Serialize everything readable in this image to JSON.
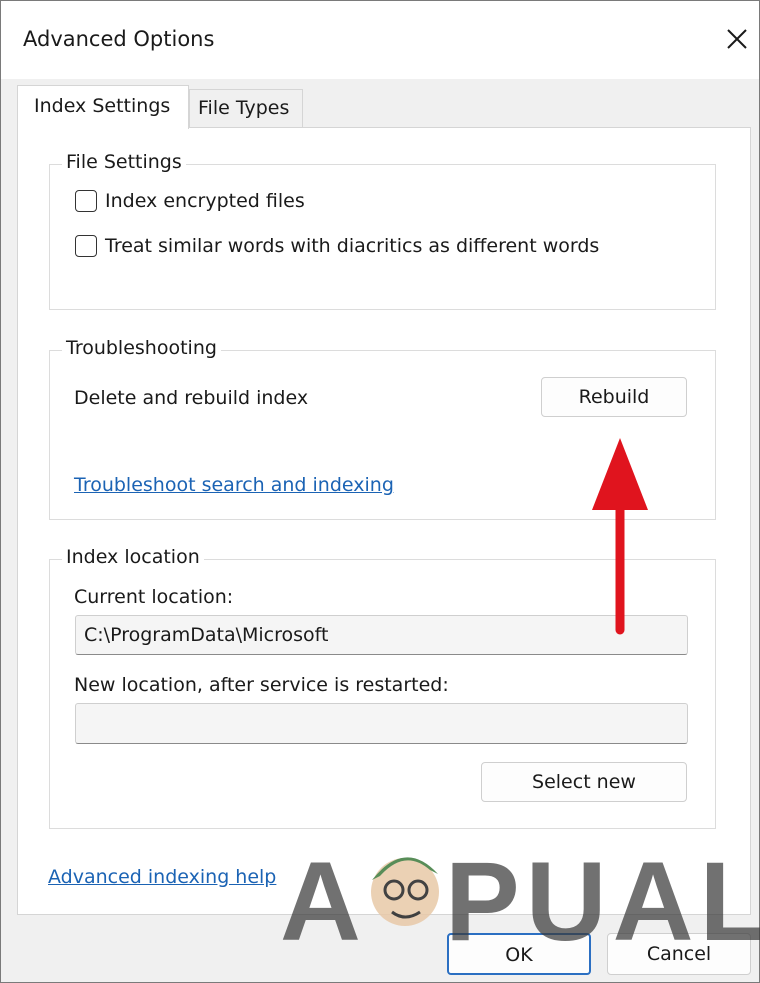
{
  "window": {
    "title": "Advanced Options",
    "close_icon": "close-icon"
  },
  "tabs": [
    {
      "label": "Index Settings",
      "active": true
    },
    {
      "label": "File Types",
      "active": false
    }
  ],
  "file_settings": {
    "legend": "File Settings",
    "options": [
      {
        "label": "Index encrypted files",
        "checked": false
      },
      {
        "label": "Treat similar words with diacritics as different words",
        "checked": false
      }
    ]
  },
  "troubleshooting": {
    "legend": "Troubleshooting",
    "rebuild_text": "Delete and rebuild index",
    "rebuild_button": "Rebuild",
    "troubleshoot_link": "Troubleshoot search and indexing"
  },
  "index_location": {
    "legend": "Index location",
    "current_label": "Current location:",
    "current_value": "C:\\ProgramData\\Microsoft",
    "new_label": "New location, after service is restarted:",
    "new_value": "",
    "select_button": "Select new"
  },
  "help_link": "Advanced indexing help",
  "footer": {
    "ok_button": "OK",
    "cancel_button": "Cancel"
  },
  "watermark_text": "APPUALS",
  "colors": {
    "link": "#1b63b4",
    "arrow": "#e0141e",
    "window_bg": "#f0f0f0",
    "panel_bg": "#ffffff"
  }
}
